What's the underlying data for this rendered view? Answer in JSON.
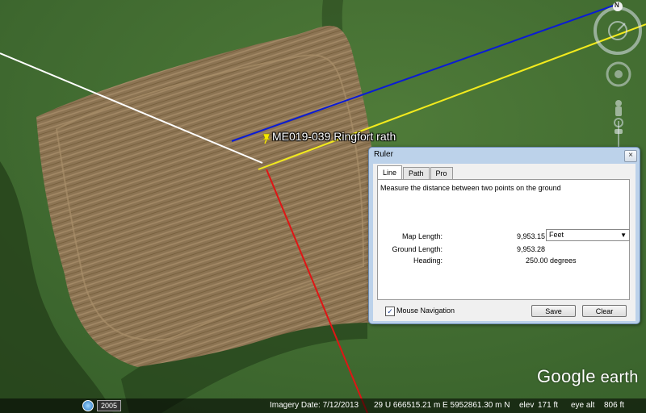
{
  "placemark": {
    "label": "ME019-039 Ringfort rath",
    "pin_icon": "yellow-pushpin-icon"
  },
  "compass": {
    "north_label": "N"
  },
  "logo": {
    "text_google": "Google",
    "text_earth": " earth"
  },
  "history": {
    "year": "2005"
  },
  "status": {
    "imagery_date": "Imagery Date: 7/12/2013",
    "coords": "29 U 666515.21 m E 5952861.30 m N",
    "elev": "elev",
    "elev_value": "171 ft",
    "eye_alt": "eye alt",
    "eye_alt_value": "806 ft"
  },
  "ruler": {
    "title": "Ruler",
    "close": "×",
    "tabs": [
      "Line",
      "Path",
      "Pro"
    ],
    "description": "Measure the distance between two points on the ground",
    "map_length_label": "Map Length:",
    "map_length_value": "9,953.15",
    "unit_selected": "Feet",
    "ground_length_label": "Ground Length:",
    "ground_length_value": "9,953.28",
    "heading_label": "Heading:",
    "heading_value": "250.00 degrees",
    "mouse_nav_label": "Mouse Navigation",
    "mouse_nav_checked": "✓",
    "save_label": "Save",
    "clear_label": "Clear"
  },
  "colors": {
    "field": "#8a7152",
    "grass": "#3f6a2f",
    "line_blue": "#0a1bd6",
    "line_yellow": "#f2ea1d",
    "line_red": "#e01515",
    "line_white": "#ffffff"
  }
}
